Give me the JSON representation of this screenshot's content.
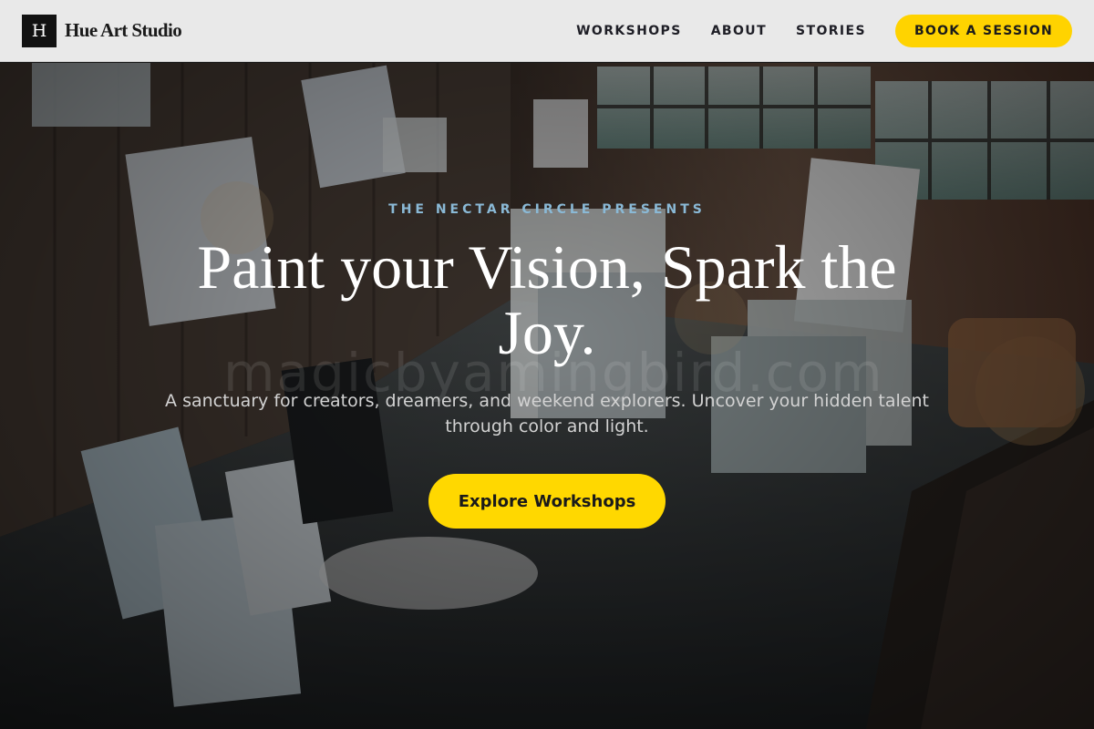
{
  "brand": {
    "logo_letter": "H",
    "name": "Hue Art Studio"
  },
  "nav": {
    "links": [
      {
        "label": "WORKSHOPS"
      },
      {
        "label": "ABOUT"
      },
      {
        "label": "STORIES"
      }
    ],
    "cta_label": "BOOK A SESSION"
  },
  "hero": {
    "eyebrow": "THE NECTAR CIRCLE PRESENTS",
    "headline": "Paint your Vision, Spark the Joy.",
    "subtext": "A sanctuary for creators, dreamers, and weekend explorers. Uncover your hidden talent through color and light.",
    "cta_label": "Explore Workshops",
    "background_image": "art-studio-interior-photo",
    "watermark": "magicbyamingbird.com"
  },
  "colors": {
    "accent": "#ffd300",
    "eyebrow": "#8ab9d6",
    "nav_bg": "#e9e9e9",
    "headline": "#ffffff"
  }
}
